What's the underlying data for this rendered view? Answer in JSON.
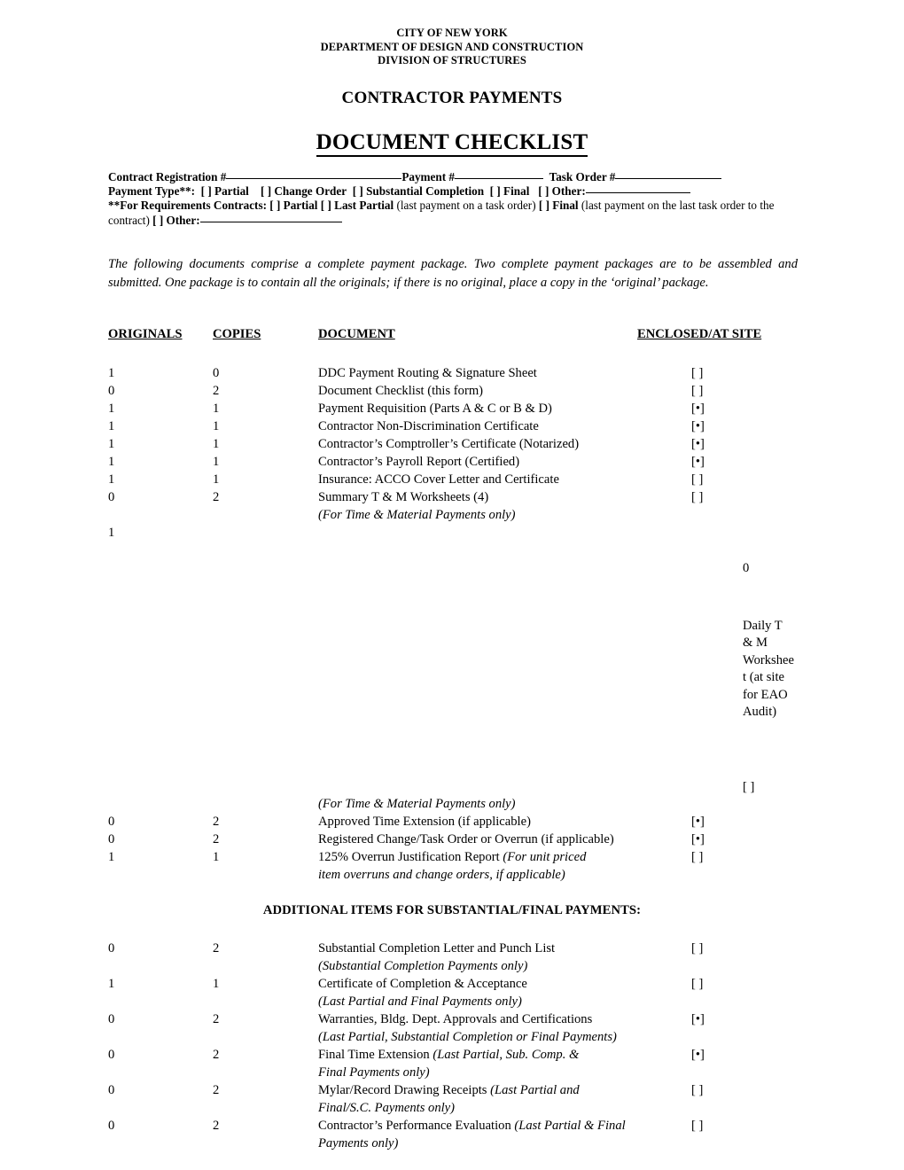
{
  "header": {
    "agency_lines": [
      "CITY OF NEW YORK",
      "DEPARTMENT OF DESIGN AND CONSTRUCTION",
      "DIVISION OF STRUCTURES"
    ],
    "section_title": "CONTRACTOR PAYMENTS",
    "document_title": "DOCUMENT CHECKLIST"
  },
  "contract_info": {
    "registration_label": "Contract Registration #",
    "payment_label": "Payment #",
    "task_order_label": "Task Order #",
    "payment_type_label": "Payment Type**:",
    "payment_type_options": [
      "[ ] Partial",
      "[ ] Change Order",
      "[ ] Substantial Completion",
      "[ ] Final",
      "[ ] Other:"
    ],
    "requirements_prefix": "**For Requirements Contracts:",
    "requirements_opt1": "[ ] Partial",
    "requirements_opt2": "[ ] Last Partial",
    "requirements_note1": "(last payment on a task order)",
    "requirements_opt3": "[ ] Final",
    "requirements_note2": "(last payment on the last task order to the contract)",
    "requirements_opt4": "[ ] Other:"
  },
  "intro_paragraph": "The following documents comprise a complete payment package. Two complete payment packages are to be assembled and submitted. One package is to contain all the originals; if there is no original, place a copy in the ‘original’ package.",
  "table": {
    "columns": {
      "originals": "ORIGINALS",
      "copies": "COPIES",
      "document": "DOCUMENT",
      "enclosed": "ENCLOSED/AT SITE"
    },
    "rows": [
      {
        "originals": "1",
        "copies": "0",
        "document": "DDC Payment Routing & Signature Sheet",
        "enclosed": "[ ]"
      },
      {
        "originals": "0",
        "copies": "2",
        "document": "Document Checklist (this form)",
        "enclosed": "[ ]"
      },
      {
        "originals": "1",
        "copies": "1",
        "document": "Payment Requisition (Parts A & C or B & D)",
        "enclosed": "[•]"
      },
      {
        "originals": "1",
        "copies": "1",
        "document": "Contractor Non-Discrimination Certificate",
        "enclosed": "[•]"
      },
      {
        "originals": "1",
        "copies": "1",
        "document": "Contractor’s Comptroller’s Certificate (Notarized)",
        "enclosed": "[•]"
      },
      {
        "originals": "1",
        "copies": "1",
        "document": "Contractor’s Payroll Report (Certified)",
        "enclosed": "[•]"
      },
      {
        "originals": "1",
        "copies": "1",
        "document": "Insurance: ACCO Cover Letter and Certificate",
        "enclosed": "[ ]"
      },
      {
        "originals": "0",
        "copies": "2",
        "document": "Summary T & M Worksheets (4)",
        "enclosed": "[ ]",
        "note": "(For Time & Material Payments only)"
      }
    ],
    "orphan_original": "1",
    "narrow_column": {
      "copies_value": "0",
      "document": "Daily T & M Worksheet (at site for EAO Audit)",
      "enclosed": "[ ]"
    },
    "orphan_note": "(For Time & Material Payments only)",
    "rows_continued": [
      {
        "originals": "0",
        "copies": "2",
        "document": "Approved Time Extension (if applicable)",
        "enclosed": "[•]"
      },
      {
        "originals": "0",
        "copies": "2",
        "document": "Registered Change/Task Order or Overrun (if applicable)",
        "enclosed": "[•]"
      },
      {
        "originals": "1",
        "copies": "1",
        "document": "125% Overrun Justification Report ",
        "document_italic": "(For unit priced",
        "enclosed": "[ ]",
        "note": "item overruns and change orders, if applicable)"
      }
    ]
  },
  "additional_heading": "ADDITIONAL ITEMS FOR SUBSTANTIAL/FINAL PAYMENTS:",
  "additional_rows": [
    {
      "originals": "0",
      "copies": "2",
      "document": "Substantial Completion Letter and Punch List",
      "enclosed": "[ ]",
      "note": "(Substantial Completion Payments only)"
    },
    {
      "originals": "1",
      "copies": "1",
      "document": "Certificate of Completion & Acceptance",
      "enclosed": "[ ]",
      "note": "(Last Partial and Final Payments only)"
    },
    {
      "originals": "0",
      "copies": "2",
      "document": "Warranties, Bldg. Dept. Approvals and Certifications",
      "enclosed": "[•]",
      "note": "(Last Partial, Substantial Completion or Final Payments)"
    },
    {
      "originals": "0",
      "copies": "2",
      "document": "Final Time Extension ",
      "document_italic": "(Last Partial, Sub. Comp. &",
      "enclosed": "[•]",
      "note": "Final Payments only)"
    },
    {
      "originals": "0",
      "copies": "2",
      "document": "Mylar/Record Drawing Receipts ",
      "document_italic": "(Last Partial and",
      "enclosed": "[ ]",
      "note": "Final/S.C. Payments only)"
    },
    {
      "originals": "0",
      "copies": "2",
      "document": "Contractor’s Performance Evaluation ",
      "document_italic": "(Last Partial & Final",
      "enclosed": "[ ]",
      "note": "Payments only)"
    }
  ]
}
